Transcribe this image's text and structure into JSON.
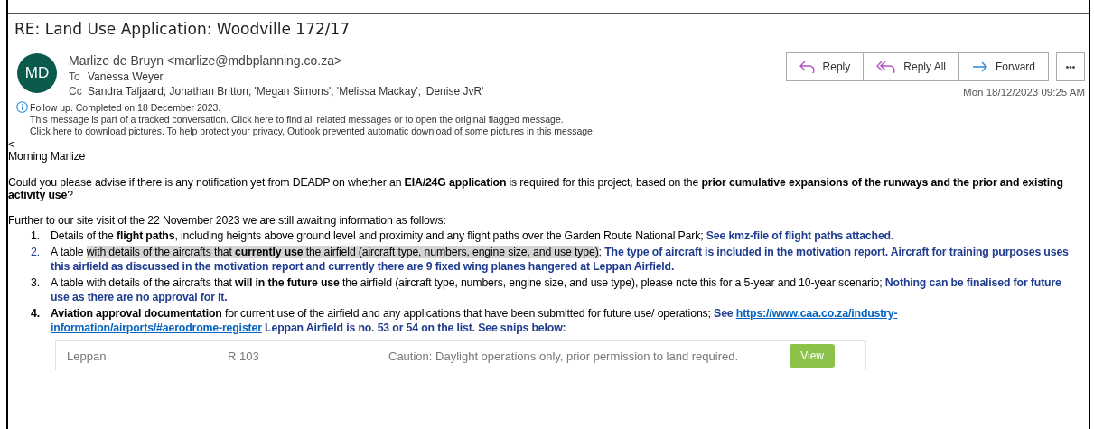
{
  "subject": "RE: Land Use Application: Woodville 172/17",
  "sender": {
    "initials": "MD",
    "name": "Marlize de Bruyn <marlize@mdbplanning.co.za>",
    "to_label": "To",
    "to": "Vanessa Weyer",
    "cc_label": "Cc",
    "cc": "Sandra Taljaard; Johathan Britton; 'Megan Simons'; 'Melissa Mackay'; 'Denise JvR'"
  },
  "actions": [
    {
      "label": "Reply",
      "kind": "reply"
    },
    {
      "label": "Reply All",
      "kind": "reply_all"
    },
    {
      "label": "Forward",
      "kind": "forward"
    }
  ],
  "more": "•••",
  "date": "Mon 18/12/2023 09:25 AM",
  "info": [
    "Follow up.  Completed on 18 December 2023.",
    "This message is part of a tracked conversation. Click here to find all related messages or to open the original flagged message.",
    "Click here to download pictures. To help protect your privacy, Outlook prevented automatic download of some pictures in this message."
  ],
  "body": {
    "stray": "<",
    "greeting": "Morning Marlize",
    "question": "Could you please advise if there is any notification yet from DEADP on whether an **EIA/24G application** is required for this project, based on the **prior cumulative expansions of the runways and the prior and existing activity use**?",
    "intro": "Further to our site visit of the 22 November 2023 we are still awaiting information as follows:",
    "items": [
      {
        "number": "1.",
        "kind": "plain",
        "segments": [
          {
            "kind": "text",
            "text": "Details of the "
          },
          {
            "kind": "bold",
            "text": "flight paths"
          },
          {
            "kind": "text",
            "text": ", including heights above ground level and proximity and any flight paths over the Garden Route National Park;  "
          },
          {
            "kind": "reply",
            "text": "See kmz-file of flight paths attached."
          }
        ]
      },
      {
        "number": "2.",
        "kind": "reply",
        "segments": [
          {
            "kind": "text",
            "text": "A table "
          },
          {
            "kind": "highlight",
            "text": "with details of the aircrafts that "
          },
          {
            "kind": "highlight_bold",
            "text": "currently use"
          },
          {
            "kind": "highlight",
            "text": " the airfield (aircraft type, numbers, engine size, and use type)"
          },
          {
            "kind": "text",
            "text": ";  "
          },
          {
            "kind": "reply",
            "text": "The type of aircraft is included in the motivation report.  Aircraft for training purposes uses this airfield as discussed in the motivation report and currently there are 9 fixed wing planes hangered at Leppan Airfield."
          }
        ]
      },
      {
        "number": "3.",
        "kind": "plain",
        "segments": [
          {
            "kind": "text",
            "text": "A table with details of the aircrafts that "
          },
          {
            "kind": "bold",
            "text": "will in the future use"
          },
          {
            "kind": "text",
            "text": " the airfield (aircraft type, numbers, engine size, and use type), please note this for a 5-year and 10-year scenario;  "
          },
          {
            "kind": "reply",
            "text": "Nothing can be finalised for future use as there are no approval for it."
          }
        ]
      },
      {
        "number": "4.",
        "kind": "bold",
        "segments": [
          {
            "kind": "bold",
            "text": "Aviation approval documentation"
          },
          {
            "kind": "text",
            "text": " for current use of the airfield and any applications that have been submitted for future use/ operations;  "
          },
          {
            "kind": "reply",
            "text": "See "
          },
          {
            "kind": "link",
            "text": "https://www.caa.co.za/industry-"
          },
          {
            "kind": "link",
            "text": "information/airports/#aerodrome-register"
          },
          {
            "kind": "reply",
            "text": "  Leppan Airfield is no. 53 or 54 on the list.  See snips below:"
          }
        ]
      }
    ],
    "snip": {
      "cells": [
        "Leppan",
        "R 103",
        "Caution: Daylight operations only, prior permission to land required."
      ],
      "button": "View"
    }
  }
}
